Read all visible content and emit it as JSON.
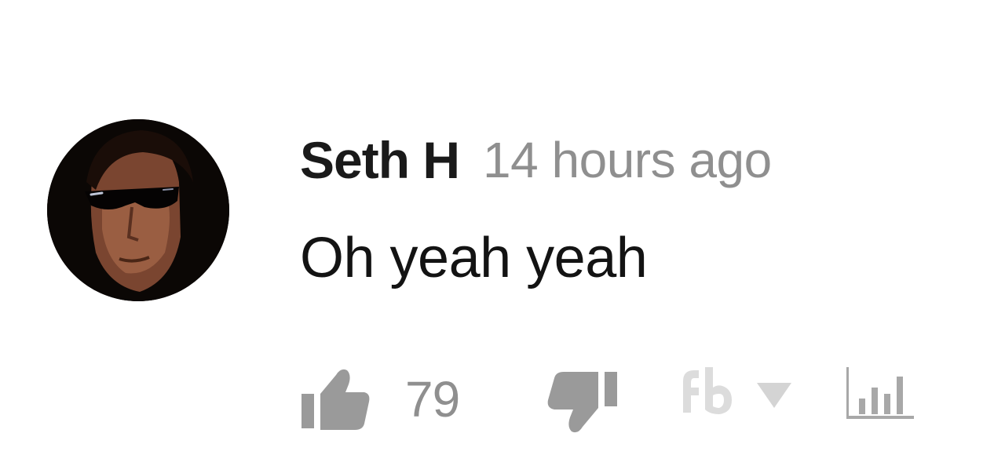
{
  "comment": {
    "author": "Seth H",
    "timestamp": "14 hours ago",
    "text": "Oh yeah yeah",
    "like_count": "79"
  },
  "icons": {
    "like": "thumbs-up-icon",
    "dislike": "thumbs-down-icon",
    "facebook": "fb-icon",
    "dropdown": "caret-down-icon",
    "stats": "bar-chart-icon"
  },
  "colors": {
    "author": "#1a1a1a",
    "meta": "#8f8f8f",
    "icon": "#9a9a9a"
  }
}
